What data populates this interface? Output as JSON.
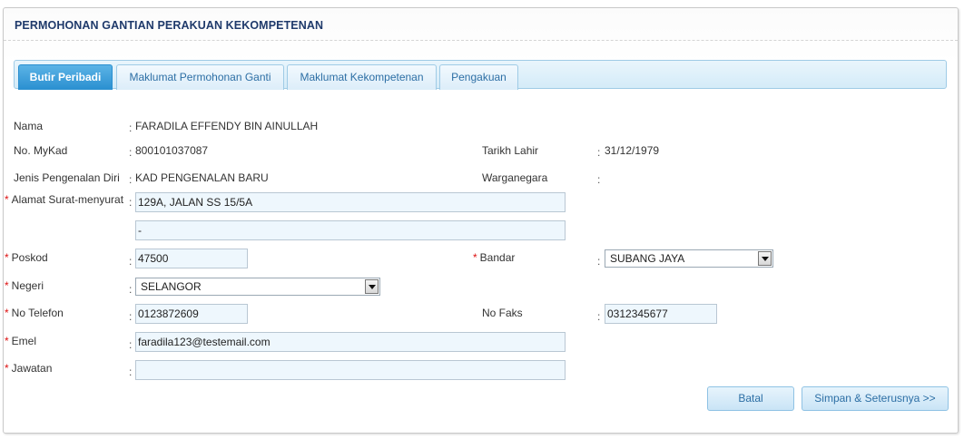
{
  "title": "PERMOHONAN GANTIAN PERAKUAN KEKOMPETENAN",
  "tabs": [
    {
      "label": "Butir Peribadi",
      "active": true
    },
    {
      "label": "Maklumat Permohonan Ganti",
      "active": false
    },
    {
      "label": "Maklumat Kekompetenan",
      "active": false
    },
    {
      "label": "Pengakuan",
      "active": false
    }
  ],
  "fields": {
    "nama": {
      "label": "Nama",
      "value": "FARADILA EFFENDY BIN AINULLAH"
    },
    "mykad": {
      "label": "No. MyKad",
      "value": "800101037087"
    },
    "tarikh_lahir": {
      "label": "Tarikh Lahir",
      "value": "31/12/1979"
    },
    "jenis_pengenalan": {
      "label": "Jenis Pengenalan Diri",
      "value": "KAD PENGENALAN BARU"
    },
    "warganegara": {
      "label": "Warganegara",
      "value": ""
    },
    "alamat": {
      "label": "Alamat Surat-menyurat",
      "line1": "129A, JALAN SS 15/5A",
      "line2": "-"
    },
    "poskod": {
      "label": "Poskod",
      "value": "47500"
    },
    "bandar": {
      "label": "Bandar",
      "value": "SUBANG JAYA"
    },
    "negeri": {
      "label": "Negeri",
      "value": "SELANGOR"
    },
    "no_telefon": {
      "label": "No Telefon",
      "value": "0123872609"
    },
    "no_faks": {
      "label": "No Faks",
      "value": "0312345677"
    },
    "emel": {
      "label": "Emel",
      "value": "faradila123@testemail.com"
    },
    "jawatan": {
      "label": "Jawatan",
      "value": ""
    }
  },
  "required_marker": "*",
  "colon": ":",
  "buttons": {
    "batal": "Batal",
    "simpan": "Simpan & Seterusnya >>"
  },
  "colors": {
    "title": "#1f3a6b",
    "active_tab": "#2a8fd0",
    "required": "#dd1111",
    "input_bg": "#eef7fd"
  }
}
